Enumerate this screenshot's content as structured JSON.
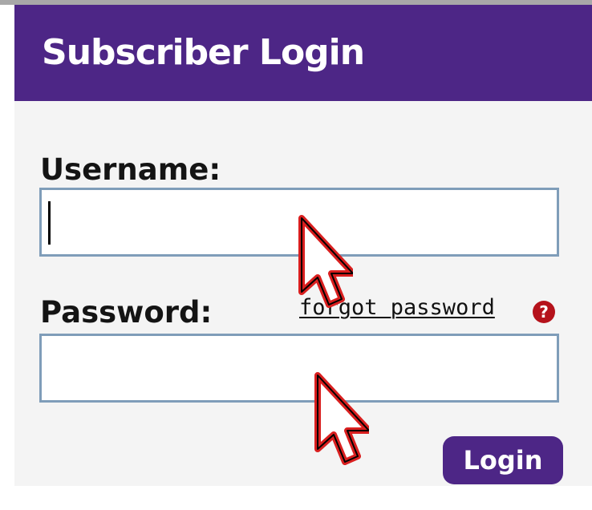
{
  "header": {
    "title": "Subscriber Login"
  },
  "form": {
    "username_label": "Username:",
    "username_value": "",
    "password_label": "Password:",
    "password_value": "",
    "forgot_password_link": "forgot password",
    "help_icon": "question-mark-icon",
    "help_icon_glyph": "?",
    "login_label": "Login"
  },
  "colors": {
    "brand_purple": "#4d2686",
    "help_red": "#b5121b",
    "field_border": "#7f9db9",
    "panel_background": "#f4f4f4"
  }
}
